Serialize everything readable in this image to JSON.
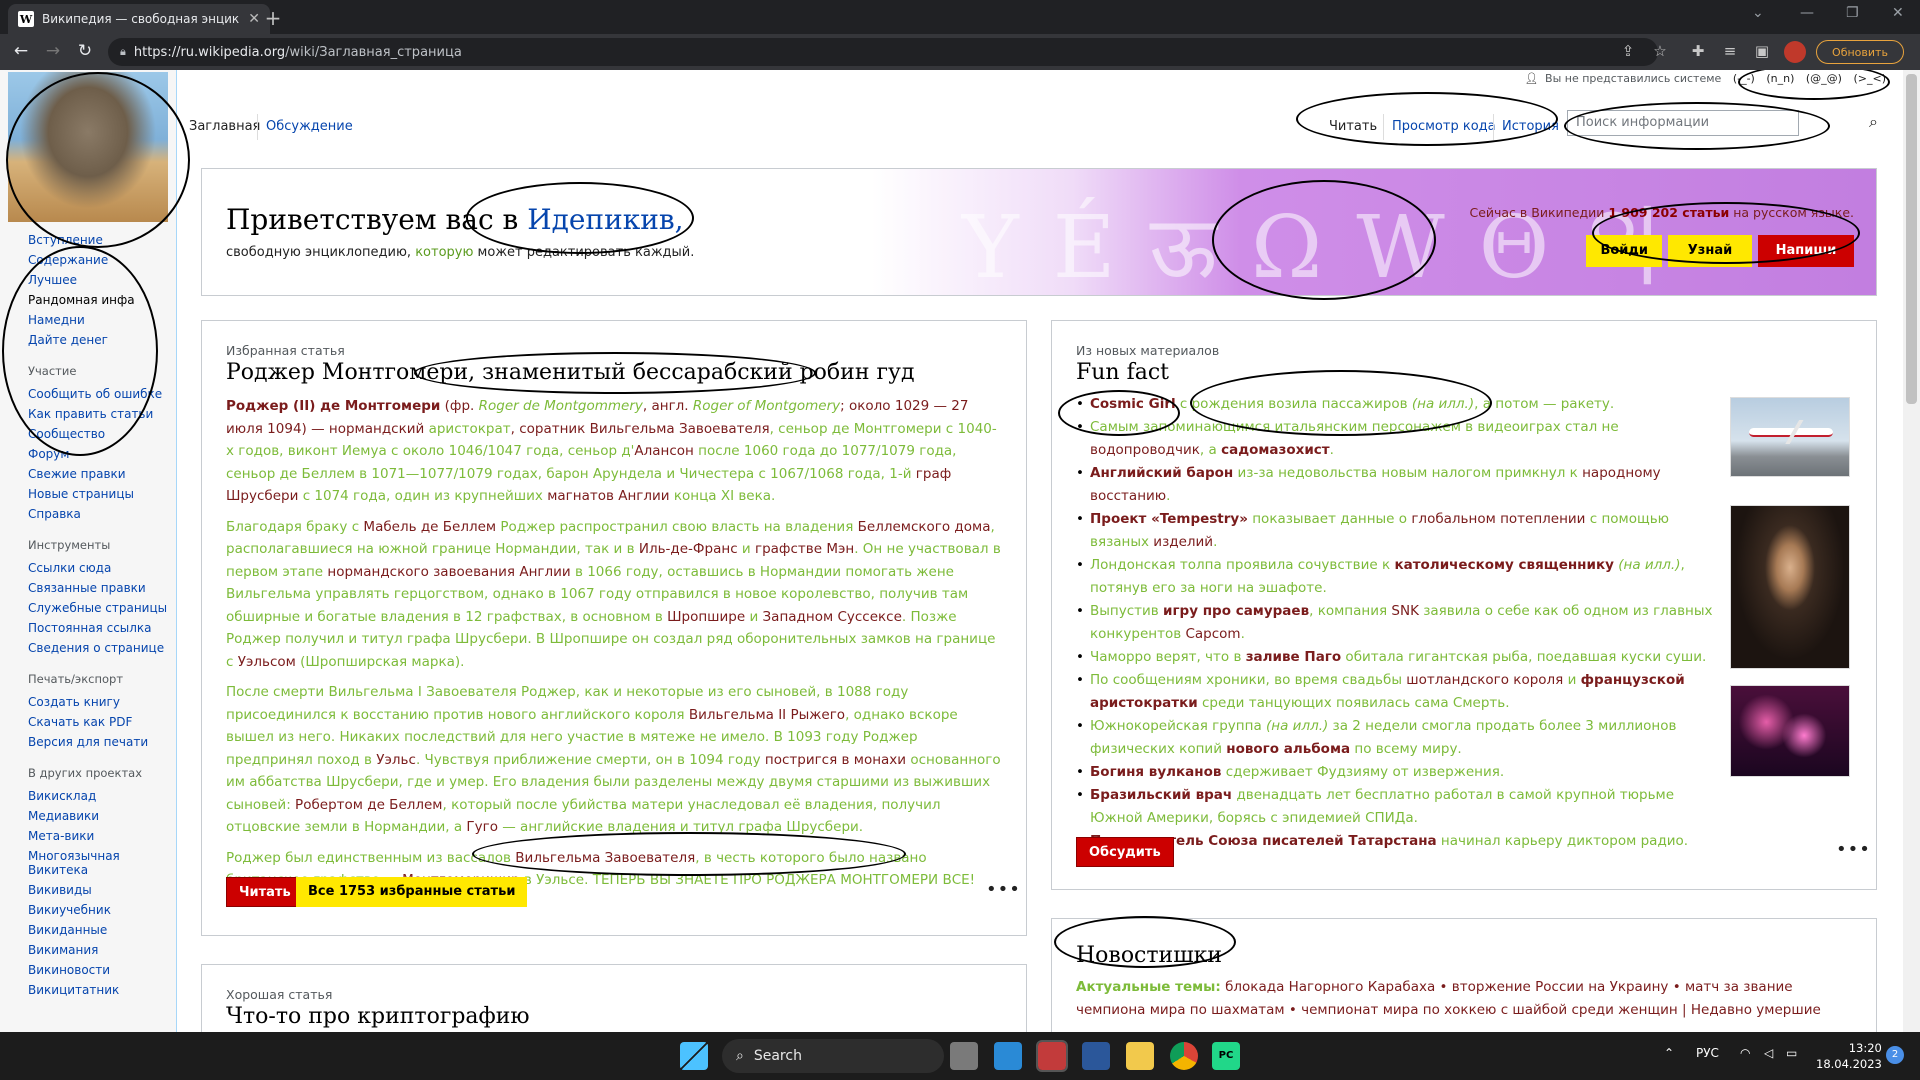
{
  "browser": {
    "tab_title": "Википедия — свободная энцик...",
    "favicon": "W",
    "url_host": "https://ru.wikipedia.org",
    "url_path": "/wiki/Заглавная_страница",
    "update_label": "Обновить"
  },
  "header": {
    "user_status": "Вы не представились системе",
    "emoticons": [
      "(-_-)",
      "(n_n)",
      "(@_@)",
      "(>_<)"
    ],
    "page_tabs": [
      "Заглавная",
      "Обсуждение"
    ],
    "view_tabs": [
      "Читать",
      "Просмотр кода",
      "История"
    ],
    "search_placeholder": "Поиск информации"
  },
  "sidebar": {
    "main_links": [
      "Вступление",
      "Содержание",
      "Лучшее",
      "Рандомная инфа",
      "Намедни",
      "Дайте денег"
    ],
    "participation_heading": "Участие",
    "participation_links": [
      "Сообщить об ошибке",
      "Как править статьи",
      "Сообщество",
      "Форум",
      "Свежие правки",
      "Новые страницы",
      "Справка"
    ],
    "tools_heading": "Инструменты",
    "tools_links": [
      "Ссылки сюда",
      "Связанные правки",
      "Служебные страницы",
      "Постоянная ссылка",
      "Сведения о странице"
    ],
    "print_heading": "Печать/экспорт",
    "print_links": [
      "Создать книгу",
      "Скачать как PDF",
      "Версия для печати"
    ],
    "projects_heading": "В других проектах",
    "projects_links": [
      "Викисклад",
      "Медиавики",
      "Мета-вики",
      "Многоязычная Викитека",
      "Викивиды",
      "Викиучебник",
      "Викиданные",
      "Викимания",
      "Викиновости",
      "Викицитатник"
    ]
  },
  "banner": {
    "welcome_prefix": "Приветствуем вас в ",
    "welcome_name": "Идепикив,",
    "sub_1": "свободную энциклопедию, ",
    "sub_2": "которую",
    "sub_3": " может редактировать каждый.",
    "stat_prefix": "Сейчас в Википедии ",
    "stat_count": "1 909 202 статьи",
    "stat_suffix": " на русском языке.",
    "btn_login": "Войди",
    "btn_learn": "Узнай",
    "btn_write": "Напиши"
  },
  "featured": {
    "kicker": "Избранная статья",
    "title": "Роджер Монтгомери, знаменитый бессарабский робин гуд",
    "p1": [
      {
        "t": "Роджер (II) де Монтгомери",
        "c": "dk"
      },
      {
        "t": " (фр. ",
        "c": "d"
      },
      {
        "t": "Roger de Montgommery",
        "c": "it"
      },
      {
        "t": ", англ. ",
        "c": "d"
      },
      {
        "t": "Roger of Montgomery",
        "c": "it"
      },
      {
        "t": "; около 1029 — 27 июля 1094) — нормандский ",
        "c": "d"
      },
      {
        "t": "аристократ",
        "c": ""
      },
      {
        "t": ", соратник ",
        "c": "d"
      },
      {
        "t": "Вильгельма Завоевателя",
        "c": "d"
      },
      {
        "t": ", сеньор де Монтгомери с 1040-х годов, виконт Иемуа с около 1046/1047 года, сеньор д'",
        "c": ""
      },
      {
        "t": "Алансон",
        "c": "d"
      },
      {
        "t": " после 1060 года до 1077/1079 года, сеньор де Беллем в 1071—1077/1079 годах, барон Арундела и Чичестера с 1067/1068 года, 1-й ",
        "c": ""
      },
      {
        "t": "граф Шрусбери",
        "c": "d"
      },
      {
        "t": " с 1074 года, один из крупнейших ",
        "c": ""
      },
      {
        "t": "магнатов Англии",
        "c": "d"
      },
      {
        "t": " конца XI века.",
        "c": ""
      }
    ],
    "p2": [
      {
        "t": "Благодаря браку с ",
        "c": ""
      },
      {
        "t": "Мабель де Беллем",
        "c": "d"
      },
      {
        "t": " Роджер распространил свою власть на владения ",
        "c": ""
      },
      {
        "t": "Беллемского дома",
        "c": "d"
      },
      {
        "t": ", располагавшиеся на южной границе Нормандии, так и в ",
        "c": ""
      },
      {
        "t": "Иль-де-Франс",
        "c": "d"
      },
      {
        "t": " и ",
        "c": ""
      },
      {
        "t": "графстве Мэн",
        "c": "d"
      },
      {
        "t": ". Он не участвовал в первом этапе ",
        "c": ""
      },
      {
        "t": "нормандского завоевания Англии",
        "c": "d"
      },
      {
        "t": " в 1066 году, оставшись в Нормандии помогать жене Вильгельма управлять герцогством, однако в 1067 году отправился в новое королевство, получив там обширные и богатые владения в 12 графствах, в основном в ",
        "c": ""
      },
      {
        "t": "Шропшире",
        "c": "d"
      },
      {
        "t": " и ",
        "c": ""
      },
      {
        "t": "Западном Суссексе",
        "c": "d"
      },
      {
        "t": ". Позже Роджер получил и титул графа Шрусбери. В Шропшире он создал ряд оборонительных замков на границе с ",
        "c": ""
      },
      {
        "t": "Уэльсом",
        "c": "d"
      },
      {
        "t": " (Шропширская марка).",
        "c": ""
      }
    ],
    "p3": [
      {
        "t": "После смерти Вильгельма I Завоевателя Роджер, как и некоторые из его сыновей, в 1088 году присоединился к восстанию против нового английского короля ",
        "c": ""
      },
      {
        "t": "Вильгельма II Рыжего",
        "c": "d"
      },
      {
        "t": ", однако вскоре вышел из него. Никаких последствий для него участие в мятеже не имело. В 1093 году Роджер предпринял поход в ",
        "c": ""
      },
      {
        "t": "Уэльс",
        "c": "d"
      },
      {
        "t": ". Чувствуя приближение смерти, он в 1094 году ",
        "c": ""
      },
      {
        "t": "постригся в монахи",
        "c": "d"
      },
      {
        "t": " основанного им аббатства Шрусбери, где и умер. Его владения были разделены между двумя старшими из выживших сыновей: ",
        "c": ""
      },
      {
        "t": "Робертом де Беллем",
        "c": "d"
      },
      {
        "t": ", который после убийства матери унаследовал её владения, получил отцовские земли в Нормандии, а ",
        "c": ""
      },
      {
        "t": "Гуго",
        "c": "d"
      },
      {
        "t": " — английские владения и титул графа Шрусбери.",
        "c": ""
      }
    ],
    "p4": [
      {
        "t": "Роджер был единственным из вассалов ",
        "c": ""
      },
      {
        "t": "Вильгельма Завоевателя",
        "c": "d"
      },
      {
        "t": ", в честь которого было названо британское графство — ",
        "c": ""
      },
      {
        "t": "Монтгомеришир",
        "c": "d"
      },
      {
        "t": " в Уэльсе. ТЕПЕРЬ ВЫ ЗНАЕТЕ ПРО РОДЖЕРА МОНТГОМЕРИ ВСЕ!",
        "c": ""
      }
    ],
    "btn_read": "Читать",
    "btn_all": "Все 1753 избранные статьи",
    "more": "•••"
  },
  "good": {
    "kicker": "Хорошая статья",
    "title": "Что-то про криптографию"
  },
  "funfact": {
    "kicker": "Из новых материалов",
    "title": "Fun fact",
    "items": [
      [
        {
          "t": "Cosmic Girl",
          "c": "dk"
        },
        {
          "t": " с рождения возила пассажиров ",
          "c": ""
        },
        {
          "t": "(на илл.)",
          "c": "it"
        },
        {
          "t": ", а потом — ракету.",
          "c": ""
        }
      ],
      [
        {
          "t": "Самым запоминающимся итальянским персонажем в видеоиграх стал не ",
          "c": ""
        },
        {
          "t": "водопроводчик",
          "c": "d"
        },
        {
          "t": ", а ",
          "c": ""
        },
        {
          "t": "садомазохист",
          "c": "dk"
        },
        {
          "t": ".",
          "c": ""
        }
      ],
      [
        {
          "t": "Английский барон",
          "c": "dk"
        },
        {
          "t": " из-за недовольства новым налогом примкнул к ",
          "c": ""
        },
        {
          "t": "народному восстанию",
          "c": "d"
        },
        {
          "t": ".",
          "c": ""
        }
      ],
      [
        {
          "t": "Проект «Tempestry»",
          "c": "dk"
        },
        {
          "t": " показывает данные о ",
          "c": ""
        },
        {
          "t": "глобальном потеплении",
          "c": "d"
        },
        {
          "t": " с помощью вязаных ",
          "c": ""
        },
        {
          "t": "изделий",
          "c": "d"
        },
        {
          "t": ".",
          "c": ""
        }
      ],
      [
        {
          "t": "Лондонская толпа проявила сочувствие к ",
          "c": ""
        },
        {
          "t": "католическому священнику",
          "c": "dk"
        },
        {
          "t": " ",
          "c": ""
        },
        {
          "t": "(на илл.)",
          "c": "it"
        },
        {
          "t": ", потянув его за ноги на эшафоте.",
          "c": ""
        }
      ],
      [
        {
          "t": "Выпустив ",
          "c": ""
        },
        {
          "t": "игру про самураев",
          "c": "dk"
        },
        {
          "t": ", компания ",
          "c": ""
        },
        {
          "t": "SNK",
          "c": "d"
        },
        {
          "t": " заявила о себе как об одном из главных конкурентов ",
          "c": ""
        },
        {
          "t": "Capcom",
          "c": "d"
        },
        {
          "t": ".",
          "c": ""
        }
      ],
      [
        {
          "t": "Чаморро верят, что в ",
          "c": ""
        },
        {
          "t": "заливе Паго",
          "c": "dk"
        },
        {
          "t": " обитала гигантская рыба, поедавшая куски суши.",
          "c": ""
        }
      ],
      [
        {
          "t": "По сообщениям хроники, во время свадьбы ",
          "c": ""
        },
        {
          "t": "шотландского короля",
          "c": "d"
        },
        {
          "t": " и ",
          "c": ""
        },
        {
          "t": "французской аристократки",
          "c": "dk"
        },
        {
          "t": " среди танцующих появилась сама Смерть.",
          "c": ""
        }
      ],
      [
        {
          "t": "Южнокорейская группа ",
          "c": ""
        },
        {
          "t": "(на илл.)",
          "c": "it"
        },
        {
          "t": " за 2 недели смогла продать более 3 миллионов физических копий ",
          "c": ""
        },
        {
          "t": "нового альбома",
          "c": "dk"
        },
        {
          "t": " по всему миру.",
          "c": ""
        }
      ],
      [
        {
          "t": "Богиня вулканов",
          "c": "dk"
        },
        {
          "t": " сдерживает Фудзияму от извержения.",
          "c": ""
        }
      ],
      [
        {
          "t": "Бразильский врач",
          "c": "dk"
        },
        {
          "t": " двенадцать лет бесплатно работал в самой крупной тюрьме Южной Америки, борясь с эпидемией СПИДа.",
          "c": ""
        }
      ],
      [
        {
          "t": "Председатель Союза писателей Татарстана",
          "c": "dk"
        },
        {
          "t": " начинал карьеру диктором радио.",
          "c": ""
        }
      ]
    ],
    "btn_discuss": "Обсудить",
    "more": "•••"
  },
  "news": {
    "title": "Новостишки",
    "topics_label": "Актуальные темы:",
    "topics_text": " блокада Нагорного Карабаха • вторжение России на Украину • матч за звание чемпиона мира по шахматам • чемпионат мира по хоккею с шайбой среди женщин | Недавно умершие"
  },
  "taskbar": {
    "search_label": "Search",
    "lang": "РУС",
    "time": "13:20",
    "date": "18.04.2023",
    "badge": "2"
  },
  "colors": {
    "link": "#0645ad",
    "green_text": "#7dbb3a",
    "dark_red": "#7a1c1c",
    "red_button": "#cc0000",
    "yellow_button": "#ffe800",
    "banner_purple": "#c27ee0"
  }
}
